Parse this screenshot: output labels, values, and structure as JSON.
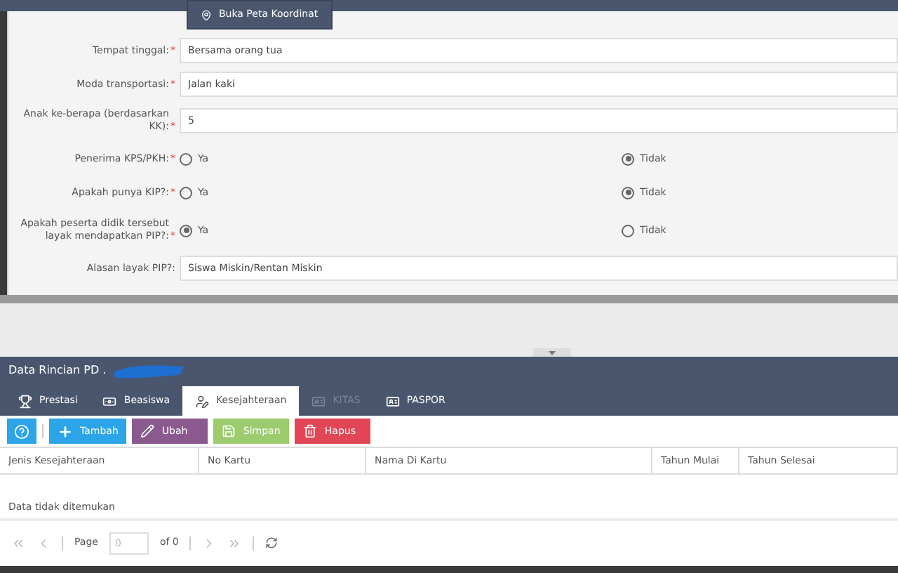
{
  "map_button": {
    "label": "Buka Peta Koordinat"
  },
  "form": [
    {
      "kind": "text",
      "label": "Tempat tinggal:",
      "required_mark": "*",
      "value": "Bersama orang tua"
    },
    {
      "kind": "text",
      "label": "Moda transportasi:",
      "required_mark": "*",
      "value": "Jalan kaki"
    },
    {
      "kind": "text",
      "label": "Anak ke-berapa (berdasarkan KK):",
      "required_mark": "*",
      "value": "5"
    },
    {
      "kind": "radio",
      "label": "Penerima KPS/PKH:",
      "required_mark": "*",
      "options": [
        {
          "label": "Ya",
          "selected": false
        },
        {
          "label": "Tidak",
          "selected": true
        }
      ]
    },
    {
      "kind": "radio",
      "label": "Apakah punya KIP?:",
      "required_mark": "*",
      "options": [
        {
          "label": "Ya",
          "selected": false
        },
        {
          "label": "Tidak",
          "selected": true
        }
      ]
    },
    {
      "kind": "radio",
      "label": "Apakah peserta didik tersebut layak mendapatkan PIP?:",
      "required_mark": "*",
      "options": [
        {
          "label": "Ya",
          "selected": true
        },
        {
          "label": "Tidak",
          "selected": false
        }
      ]
    },
    {
      "kind": "text",
      "label": "Alasan layak PIP?:",
      "value": "Siswa Miskin/Rentan Miskin"
    }
  ],
  "panel": {
    "title": "Data Rincian PD .",
    "tabs": [
      {
        "label": "Prestasi",
        "selected": false,
        "disabled": false
      },
      {
        "label": "Beasiswa",
        "selected": false,
        "disabled": false
      },
      {
        "label": "Kesejahteraan",
        "selected": true,
        "disabled": false
      },
      {
        "label": "KITAS",
        "selected": false,
        "disabled": true
      },
      {
        "label": "PASPOR",
        "selected": false,
        "disabled": false
      }
    ],
    "toolbar": [
      {
        "kind": "help"
      },
      {
        "kind": "add",
        "label": "Tambah"
      },
      {
        "kind": "edit",
        "label": "Ubah"
      },
      {
        "kind": "save",
        "label": "Simpan"
      },
      {
        "kind": "delete",
        "label": "Hapus"
      }
    ],
    "table": {
      "columns": [
        "Jenis Kesejahteraan",
        "No Kartu",
        "Nama Di Kartu",
        "Tahun Mulai",
        "Tahun Selesai"
      ],
      "empty_message": "Data tidak ditemukan"
    },
    "pager": {
      "page_label": "Page",
      "page_value": "0",
      "of_label": "of 0"
    }
  }
}
